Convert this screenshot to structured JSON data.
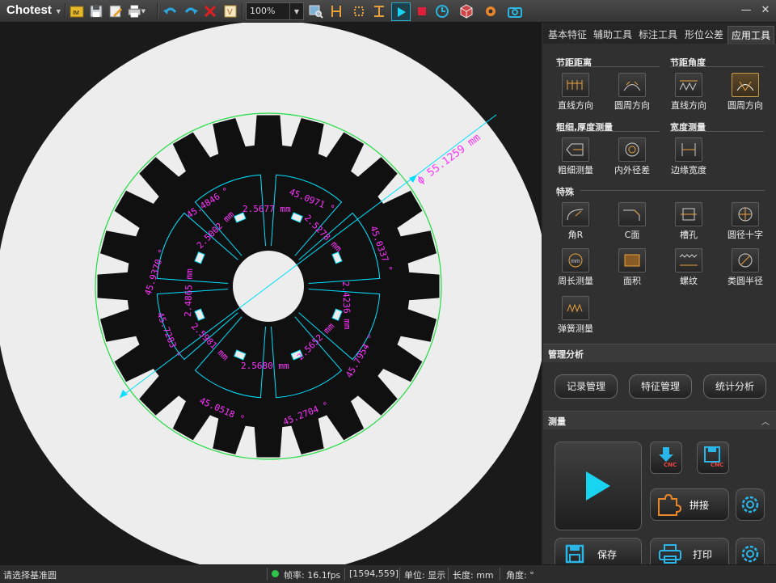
{
  "app": {
    "title": "Chotest"
  },
  "toolbar": {
    "zoom": "100%",
    "icons": [
      "im-icon",
      "save-icon",
      "edit-icon",
      "print-dropdown-icon",
      "undo-icon",
      "redo-icon",
      "delete-icon",
      "v-icon",
      "image-search-icon",
      "measure-icon",
      "bounds-icon",
      "play-icon",
      "stop-icon",
      "clock-icon",
      "cube-icon",
      "gear-icon",
      "camera-icon"
    ]
  },
  "window": {
    "minimize": "—",
    "close": "✕"
  },
  "tabs": [
    "基本特征",
    "辅助工具",
    "标注工具",
    "形位公差",
    "应用工具"
  ],
  "active_tab": "应用工具",
  "sections": {
    "pitch_distance": {
      "title": "节距距离",
      "items": [
        "直线方向",
        "圆周方向"
      ]
    },
    "pitch_angle": {
      "title": "节距角度",
      "items": [
        "直线方向",
        "圆周方向"
      ]
    },
    "thickness": {
      "title": "粗细,厚度测量",
      "items": [
        "粗细测量",
        "内外径差"
      ]
    },
    "width": {
      "title": "宽度测量",
      "items": [
        "边缘宽度"
      ]
    },
    "special": {
      "title": "特殊",
      "items": [
        "角R",
        "C面",
        "槽孔",
        "圆径十字",
        "周长测量",
        "面积",
        "螺纹",
        "类圆半径",
        "弹簧测量"
      ]
    }
  },
  "management": {
    "title": "管理分析",
    "buttons": [
      "记录管理",
      "特征管理",
      "统计分析"
    ]
  },
  "measure": {
    "title": "测量",
    "stitch": "拼接",
    "save": "保存",
    "print": "打印",
    "cnc": "CNC"
  },
  "annotations": {
    "diameter": "ϕ 55.1259 mm",
    "angles": [
      "45.4846 °",
      "45.0971 °",
      "45.0337 °",
      "45.7954 °",
      "45.2704 °",
      "45.0518 °",
      "45.7283 °",
      "45.9370 °"
    ],
    "widths": [
      "2.5677 mm",
      "2.5278 mm",
      "2.4236 mm",
      "2.5652 mm",
      "2.5680 mm",
      "2.5981 mm",
      "2.4865 mm",
      "2.5002 mm"
    ]
  },
  "colors": {
    "accent": "#00e0ff",
    "annotation": "#ff33ff",
    "circle": "#22dd44",
    "selected": "#c49a4b"
  },
  "status": {
    "prompt": "请选择基准圆",
    "fps": "帧率: 16.1fps",
    "coords": "[1594,559]",
    "unit": "单位: 显示",
    "length": "长度: mm",
    "angle": "角度: °"
  }
}
